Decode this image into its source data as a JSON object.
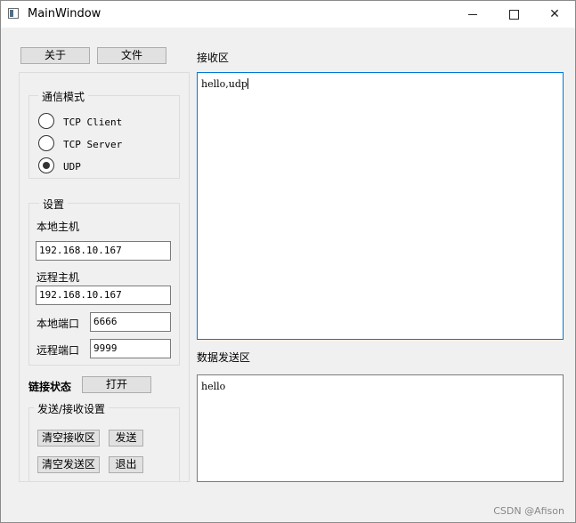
{
  "window": {
    "title": "MainWindow",
    "close_glyph": "✕"
  },
  "top_buttons": {
    "about": "关于",
    "file": "文件"
  },
  "comm_mode": {
    "title": "通信模式",
    "options": [
      {
        "label": "TCP Client",
        "checked": false
      },
      {
        "label": "TCP Server",
        "checked": false
      },
      {
        "label": "UDP",
        "checked": true
      }
    ]
  },
  "settings": {
    "title": "设置",
    "local_host_label": "本地主机",
    "local_host_value": "192.168.10.167",
    "remote_host_label": "远程主机",
    "remote_host_value": "192.168.10.167",
    "local_port_label": "本地端口",
    "local_port_value": "6666",
    "remote_port_label": "远程端口",
    "remote_port_value": "9999"
  },
  "link": {
    "status_label": "链接状态",
    "open_button": "打开"
  },
  "send_recv_settings": {
    "title": "发送/接收设置",
    "clear_recv": "清空接收区",
    "send": "发送",
    "clear_send": "清空发送区",
    "exit": "退出"
  },
  "receive_area": {
    "label": "接收区",
    "content": "hello,udp"
  },
  "send_area": {
    "label": "数据发送区",
    "content": "hello"
  },
  "watermark": "CSDN @Afison"
}
